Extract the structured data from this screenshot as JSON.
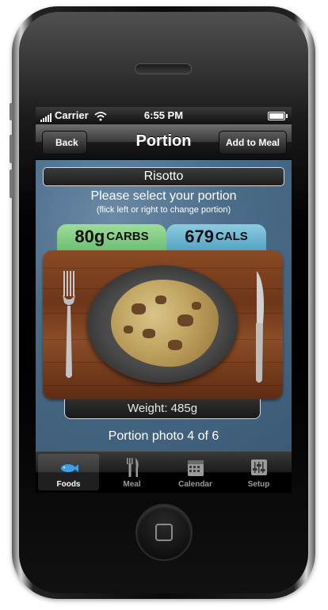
{
  "status_bar": {
    "carrier": "Carrier",
    "time": "6:55 PM"
  },
  "nav": {
    "back_label": "Back",
    "title": "Portion",
    "add_label": "Add to Meal"
  },
  "food": {
    "name": "Risotto",
    "instruction": "Please select your portion",
    "hint": "(flick left or right to change portion)",
    "carbs_value": "80g",
    "carbs_unit": "CARBS",
    "cals_value": "679",
    "cals_unit": "CALS",
    "weight": "Weight: 485g",
    "photo_count": "Portion photo 4 of 6"
  },
  "tabbar": {
    "items": [
      {
        "label": "Foods",
        "icon": "fish-icon",
        "active": true
      },
      {
        "label": "Meal",
        "icon": "fork-knife-icon",
        "active": false
      },
      {
        "label": "Calendar",
        "icon": "calendar-icon",
        "active": false
      },
      {
        "label": "Setup",
        "icon": "sliders-icon",
        "active": false
      }
    ]
  },
  "colors": {
    "carbs_tab": "#7fcf84",
    "cals_tab": "#63b0cf",
    "background": "#4b6c88",
    "active_tab_icon": "#3aa0e8"
  }
}
